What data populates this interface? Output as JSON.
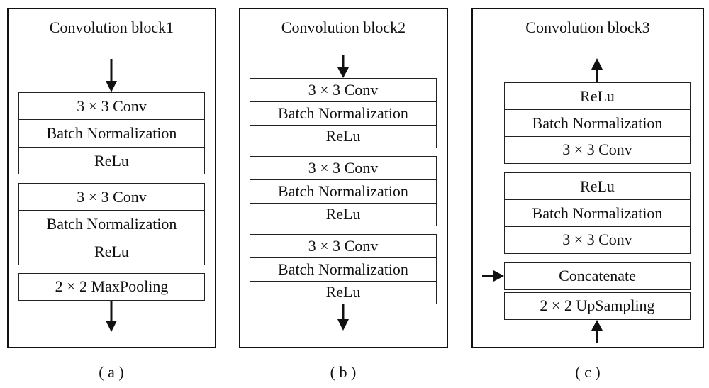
{
  "panels": [
    {
      "title": "Convolution block1",
      "caption": "( a )",
      "groups": [
        [
          "3 × 3 Conv",
          "Batch Normalization",
          "ReLu"
        ],
        [
          "3 × 3 Conv",
          "Batch Normalization",
          "ReLu"
        ],
        [
          "2 × 2 MaxPooling"
        ]
      ],
      "arrows": [
        "input-down",
        "output-down"
      ]
    },
    {
      "title": "Convolution block2",
      "caption": "( b )",
      "groups": [
        [
          "3 × 3 Conv",
          "Batch Normalization",
          "ReLu"
        ],
        [
          "3 × 3 Conv",
          "Batch Normalization",
          "ReLu"
        ],
        [
          "3 × 3 Conv",
          "Batch Normalization",
          "ReLu"
        ]
      ],
      "arrows": [
        "input-down",
        "output-down"
      ]
    },
    {
      "title": "Convolution block3",
      "caption": "( c )",
      "groups": [
        [
          "ReLu",
          "Batch Normalization",
          "3 × 3 Conv"
        ],
        [
          "ReLu",
          "Batch Normalization",
          "3 × 3 Conv"
        ],
        [
          "Concatenate"
        ],
        [
          "2 × 2 UpSampling"
        ]
      ],
      "arrows": [
        "output-up",
        "skip-input-right",
        "input-up"
      ]
    }
  ]
}
